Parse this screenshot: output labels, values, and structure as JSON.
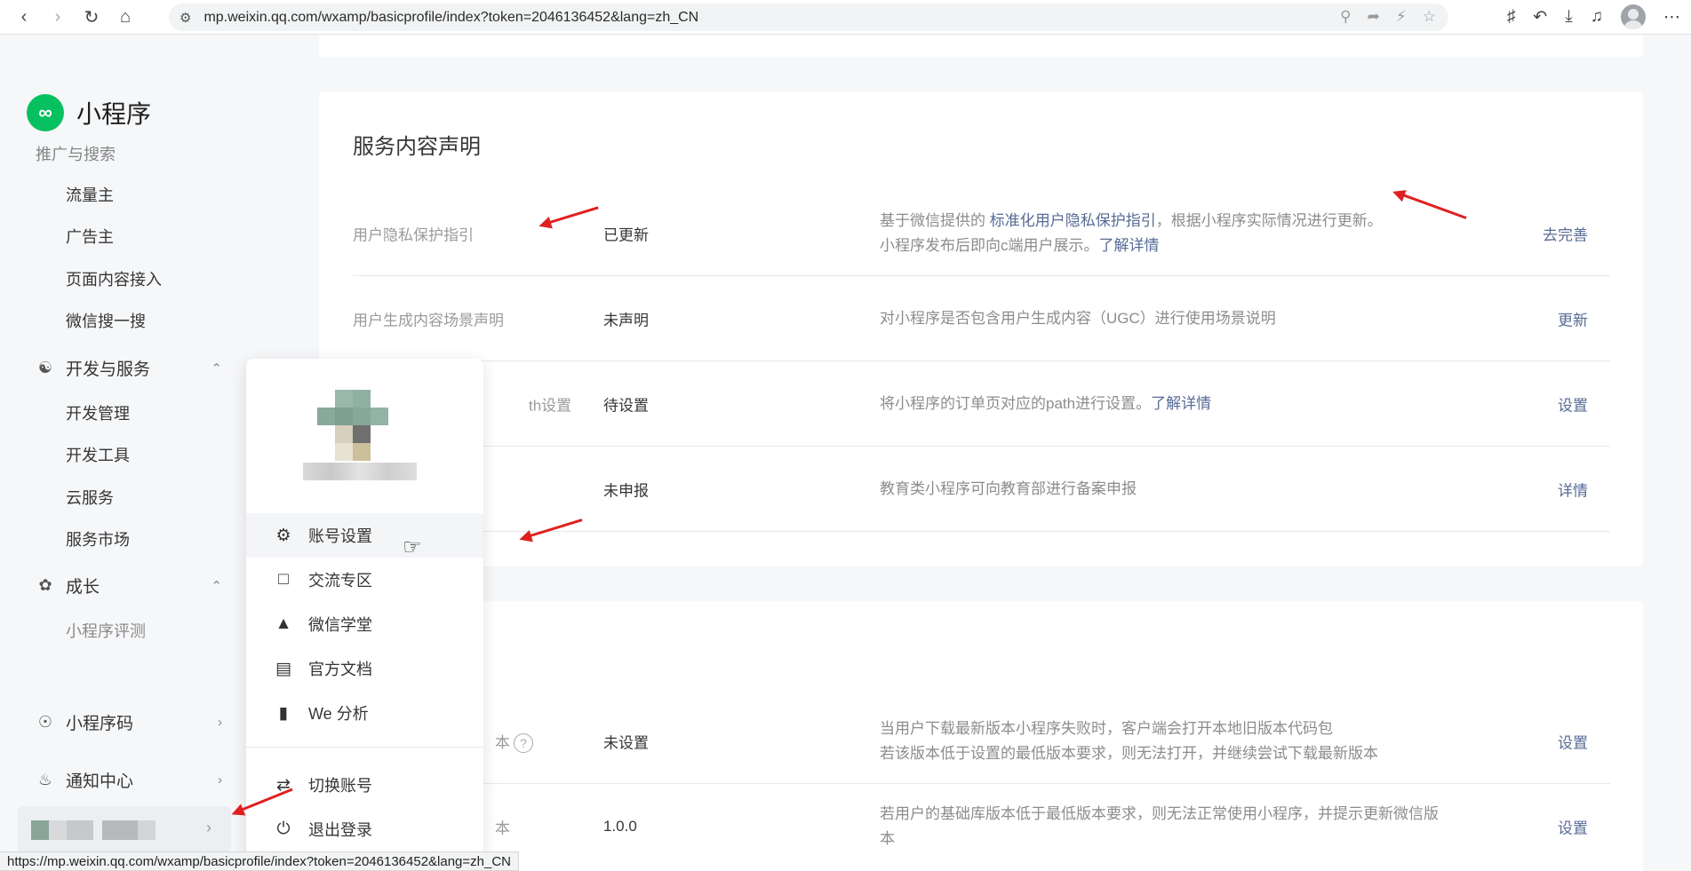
{
  "browser": {
    "url": "mp.weixin.qq.com/wxamp/basicprofile/index?token=2046136452&lang=zh_CN",
    "status_url": "https://mp.weixin.qq.com/wxamp/basicprofile/index?token=2046136452&lang=zh_CN"
  },
  "sidebar": {
    "logo_text": "小程序",
    "cut_item": "推广与搜索",
    "items": [
      {
        "label": "流量主"
      },
      {
        "label": "广告主"
      },
      {
        "label": "页面内容接入"
      },
      {
        "label": "微信搜一搜"
      }
    ],
    "groups": {
      "dev": {
        "label": "开发与服务",
        "children": [
          "开发管理",
          "开发工具",
          "云服务",
          "服务市场"
        ]
      },
      "growth": {
        "label": "成长",
        "children": [
          "小程序评测"
        ]
      },
      "qrcode": {
        "label": "小程序码"
      },
      "notify": {
        "label": "通知中心"
      }
    }
  },
  "section": {
    "title": "服务内容声明",
    "rows": [
      {
        "label": "用户隐私保护指引",
        "status": "已更新",
        "desc_prefix": "基于微信提供的 ",
        "desc_link": "标准化用户隐私保护指引",
        "desc_suffix": "，根据小程序实际情况进行更新。",
        "desc_line2": "小程序发布后即向c端用户展示。",
        "desc_link2": "了解详情",
        "action": "去完善"
      },
      {
        "label": "用户生成内容场景声明",
        "status": "未声明",
        "desc": "对小程序是否包含用户生成内容（UGC）进行使用场景说明",
        "action": "更新"
      },
      {
        "label": "订单中心path设置",
        "label_visible": "th设置",
        "status": "待设置",
        "desc": "将小程序的订单页对应的path进行设置。",
        "desc_link": "了解详情",
        "action": "设置"
      },
      {
        "status": "未申报",
        "desc": "教育类小程序可向教育部进行备案申报",
        "action": "详情"
      }
    ]
  },
  "section2": {
    "rows": [
      {
        "label_visible": "本",
        "status": "未设置",
        "desc_line1": "当用户下载最新版本小程序失败时，客户端会打开本地旧版本代码包",
        "desc_line2": "若该版本低于设置的最低版本要求，则无法打开，并继续尝试下载最新版本",
        "action": "设置"
      },
      {
        "label_visible": "本",
        "status": "1.0.0",
        "desc_line1": "若用户的基础库版本低于最低版本要求，则无法正常使用小程序，并提示更新微信版",
        "desc_line2": "本",
        "action": "设置"
      }
    ]
  },
  "dropdown": {
    "items": [
      {
        "label": "账号设置",
        "icon": "gear-icon"
      },
      {
        "label": "交流专区",
        "icon": "chat-icon"
      },
      {
        "label": "微信学堂",
        "icon": "graduation-cap-icon"
      },
      {
        "label": "官方文档",
        "icon": "document-icon"
      },
      {
        "label": "We 分析",
        "icon": "analytics-icon"
      },
      {
        "label": "切换账号",
        "icon": "switch-icon"
      },
      {
        "label": "退出登录",
        "icon": "power-icon"
      }
    ]
  },
  "colors": {
    "link": "#576b95",
    "brand": "#07c160",
    "annotation_arrow": "#e02020"
  }
}
